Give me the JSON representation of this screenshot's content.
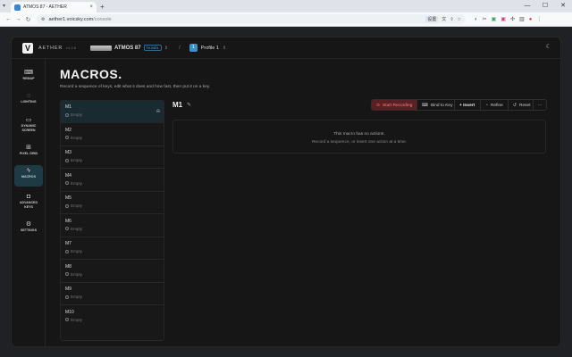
{
  "browser": {
    "tab_title": "ATMOS 87 - AETHER",
    "url_host": "aether1.voicsky.com",
    "url_path": "/console",
    "new_tab": "+",
    "translate_badge": "设置"
  },
  "app": {
    "brand": "AETHER",
    "brand_version": "v1.2.6",
    "device_name": "ATMOS 87",
    "device_badge": "Tri-MDL",
    "profile_badge": "1",
    "profile_name": "Profile 1",
    "separator": "/"
  },
  "sidebar": {
    "items": [
      {
        "label": "REMAP",
        "icon": "keyboard-icon"
      },
      {
        "label": "LIGHTING",
        "icon": "bulb-icon"
      },
      {
        "label": "DYNAMIC SCREEN",
        "icon": "monitor-icon"
      },
      {
        "label": "PIXEL GRID",
        "icon": "grid-icon"
      },
      {
        "label": "MACROS",
        "icon": "lightning-icon"
      },
      {
        "label": "ADVANCED KEYS",
        "icon": "advanced-icon"
      },
      {
        "label": "SETTINGS",
        "icon": "gear-icon"
      }
    ]
  },
  "page": {
    "title": "MACROS.",
    "subtitle": "Record a sequence of keys, edit what it does and how fast, then put it on a key."
  },
  "macros": [
    {
      "name": "M1",
      "status": "Empty"
    },
    {
      "name": "M2",
      "status": "Empty"
    },
    {
      "name": "M3",
      "status": "Empty"
    },
    {
      "name": "M4",
      "status": "Empty"
    },
    {
      "name": "M5",
      "status": "Empty"
    },
    {
      "name": "M6",
      "status": "Empty"
    },
    {
      "name": "M7",
      "status": "Empty"
    },
    {
      "name": "M8",
      "status": "Empty"
    },
    {
      "name": "M9",
      "status": "Empty"
    },
    {
      "name": "M10",
      "status": "Empty"
    }
  ],
  "editor": {
    "title": "M1",
    "toolbar": {
      "record": "Start Recording",
      "bind": "Bind to Key",
      "insert": "+ Insert",
      "refine": "Refine",
      "reset": "Reset",
      "more": "···"
    },
    "empty_line1": "This macro has no actions.",
    "empty_line2": "Record a sequence, or insert one action at a time."
  }
}
